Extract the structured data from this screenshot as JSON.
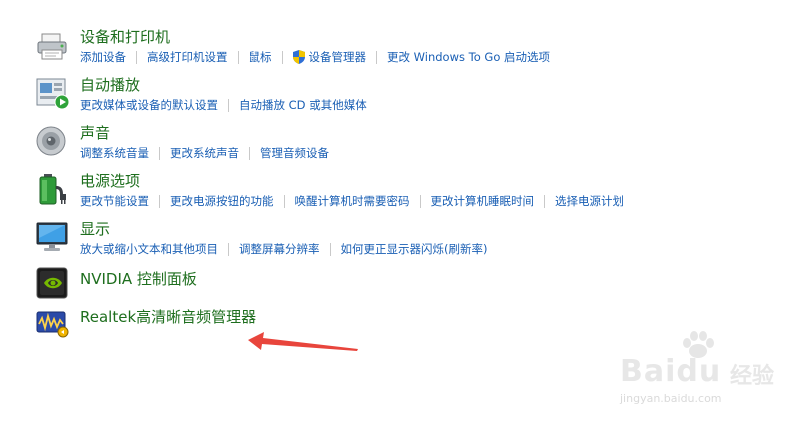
{
  "categories": {
    "devices": {
      "title": "设备和打印机",
      "links": [
        "添加设备",
        "高级打印机设置",
        "鼠标",
        "设备管理器",
        "更改 Windows To Go 启动选项"
      ]
    },
    "autoplay": {
      "title": "自动播放",
      "links": [
        "更改媒体或设备的默认设置",
        "自动播放 CD 或其他媒体"
      ]
    },
    "sound": {
      "title": "声音",
      "links": [
        "调整系统音量",
        "更改系统声音",
        "管理音频设备"
      ]
    },
    "power": {
      "title": "电源选项",
      "links": [
        "更改节能设置",
        "更改电源按钮的功能",
        "唤醒计算机时需要密码",
        "更改计算机睡眠时间",
        "选择电源计划"
      ]
    },
    "display": {
      "title": "显示",
      "links": [
        "放大或缩小文本和其他项目",
        "调整屏幕分辨率",
        "如何更正显示器闪烁(刷新率)"
      ]
    },
    "nvidia": {
      "title": "NVIDIA 控制面板"
    },
    "realtek": {
      "title": "Realtek高清晰音频管理器"
    }
  },
  "watermark": {
    "brand": "Baidu",
    "cn": "经验",
    "url": "jingyan.baidu.com"
  },
  "colors": {
    "title_green": "#1e6e1e",
    "link_blue": "#1a5fb4",
    "annotation_arrow": "#e8453c"
  },
  "icons": {
    "devices": "printer-icon",
    "autoplay": "autoplay-icon",
    "sound": "speaker-icon",
    "power": "battery-plug-icon",
    "display": "monitor-icon",
    "nvidia": "nvidia-icon",
    "realtek": "realtek-icon",
    "device_manager": "uac-shield-icon"
  }
}
